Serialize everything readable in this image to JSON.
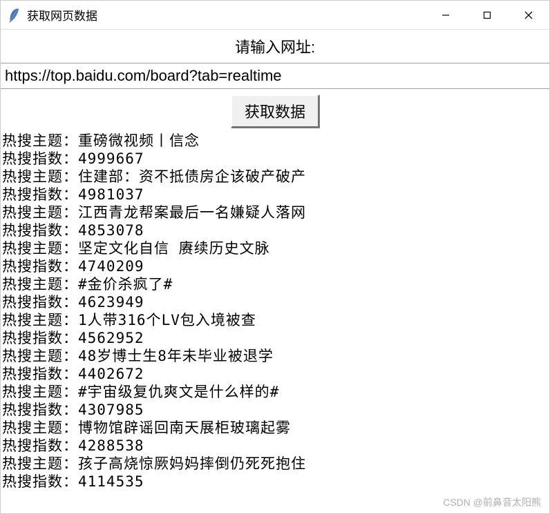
{
  "window": {
    "title": "获取网页数据"
  },
  "prompt": "请输入网址:",
  "url_value": "https://top.baidu.com/board?tab=realtime",
  "fetch_button_label": "获取数据",
  "topic_prefix": "热搜主题：",
  "index_prefix": "热搜指数：",
  "results": [
    {
      "topic": "重磅微视频丨信念",
      "index": "4999667"
    },
    {
      "topic": "住建部：资不抵债房企该破产破产",
      "index": "4981037"
    },
    {
      "topic": "江西青龙帮案最后一名嫌疑人落网",
      "index": "4853078"
    },
    {
      "topic": "坚定文化自信 赓续历史文脉",
      "index": "4740209"
    },
    {
      "topic": "#金价杀疯了#",
      "index": "4623949"
    },
    {
      "topic": "1人带316个LV包入境被查",
      "index": "4562952"
    },
    {
      "topic": "48岁博士生8年未毕业被退学",
      "index": "4402672"
    },
    {
      "topic": "#宇宙级复仇爽文是什么样的#",
      "index": "4307985"
    },
    {
      "topic": "博物馆辟谣回南天展柜玻璃起雾",
      "index": "4288538"
    },
    {
      "topic": "孩子高烧惊厥妈妈摔倒仍死死抱住",
      "index": "4114535"
    }
  ],
  "watermark": "CSDN @前鼻音太阳熊"
}
